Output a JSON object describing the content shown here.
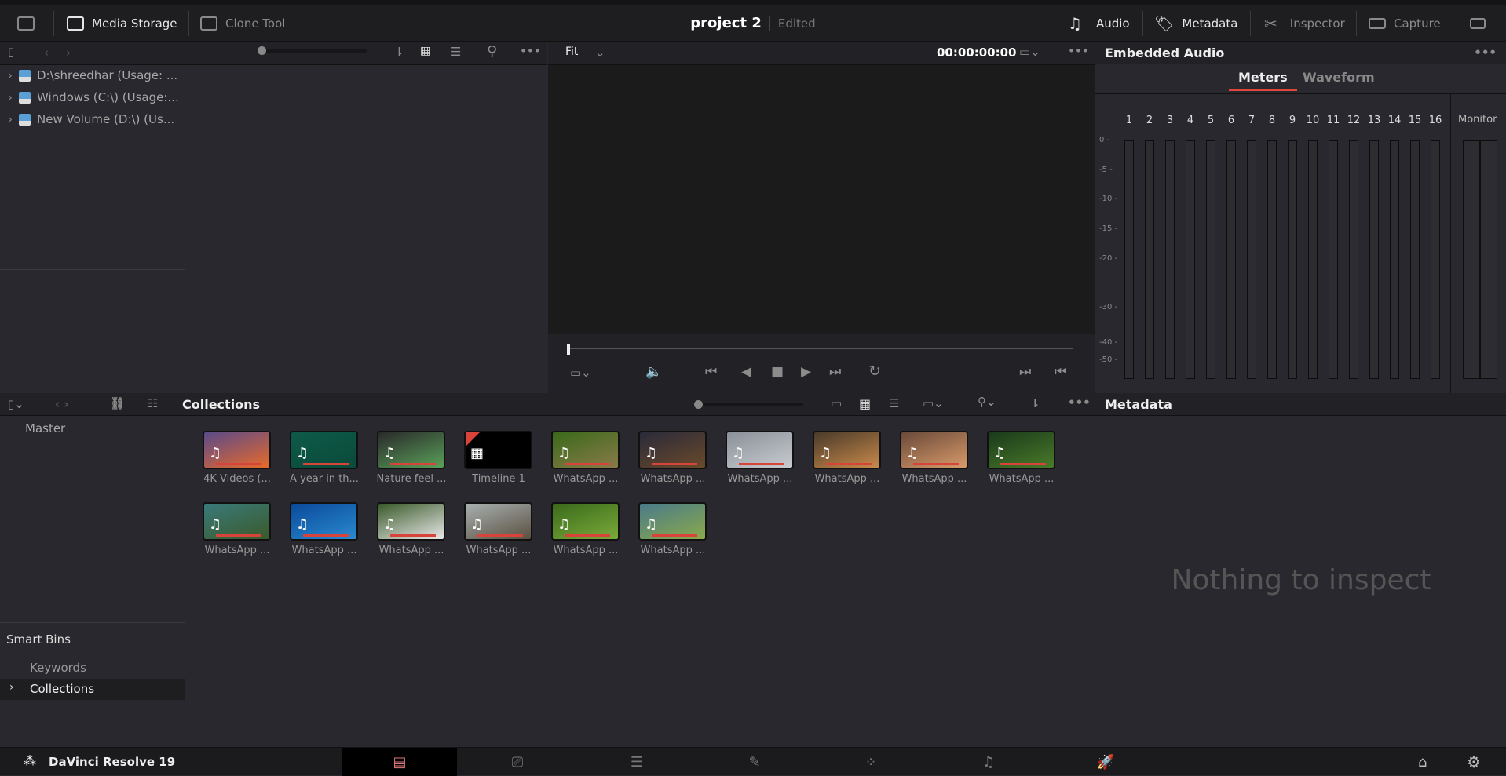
{
  "topbar": {
    "media_storage": "Media Storage",
    "clone_tool": "Clone Tool",
    "project_name": "project 2",
    "project_status": "Edited",
    "audio": "Audio",
    "metadata": "Metadata",
    "inspector": "Inspector",
    "capture": "Capture"
  },
  "viewer": {
    "zoom": "Fit",
    "timecode": "00:00:00:00"
  },
  "storage": {
    "drives": [
      "D:\\shreedhar (Usage: ...",
      "Windows (C:\\) (Usage:...",
      "New Volume (D:\\) (Us..."
    ]
  },
  "audio_panel": {
    "title": "Embedded Audio",
    "tabs": [
      "Meters",
      "Waveform"
    ],
    "active_tab": "Meters",
    "channels": [
      "1",
      "2",
      "3",
      "4",
      "5",
      "6",
      "7",
      "8",
      "9",
      "10",
      "11",
      "12",
      "13",
      "14",
      "15",
      "16"
    ],
    "monitor": "Monitor",
    "db_scale": [
      "0 -",
      "-5 -",
      "-10 -",
      "-15 -",
      "-20 -",
      "-30 -",
      "-40 -",
      "-50 -"
    ],
    "accent": "#e0463c"
  },
  "media_pool": {
    "title": "Collections",
    "bins": {
      "master": "Master",
      "smart_bins": "Smart Bins",
      "items": [
        "Keywords",
        "Collections"
      ]
    },
    "clips": [
      {
        "label": "4K Videos (...",
        "type": "audio",
        "colors": [
          "#5a4a8a",
          "#e86a2a"
        ]
      },
      {
        "label": "A year in th...",
        "type": "audio",
        "colors": [
          "#0e5a48",
          "#0a4a3a"
        ]
      },
      {
        "label": "Nature feel ...",
        "type": "waveform",
        "colors": [
          "#2a2a2a",
          "#5aa05a"
        ]
      },
      {
        "label": "Timeline 1",
        "type": "timeline",
        "colors": [
          "#000000",
          "#000000"
        ]
      },
      {
        "label": "WhatsApp ...",
        "type": "audio",
        "colors": [
          "#3a6a1a",
          "#8a7a4a"
        ]
      },
      {
        "label": "WhatsApp ...",
        "type": "audio",
        "colors": [
          "#2a2a3a",
          "#6a4a2a"
        ]
      },
      {
        "label": "WhatsApp ...",
        "type": "audio",
        "colors": [
          "#8a9098",
          "#c8ccd0"
        ]
      },
      {
        "label": "WhatsApp ...",
        "type": "audio",
        "colors": [
          "#4a3a2a",
          "#c88a4a"
        ]
      },
      {
        "label": "WhatsApp ...",
        "type": "audio",
        "colors": [
          "#6a4a3a",
          "#d89a6a"
        ]
      },
      {
        "label": "WhatsApp ...",
        "type": "audio",
        "colors": [
          "#1a3a1a",
          "#4a7a2a"
        ]
      },
      {
        "label": "WhatsApp ...",
        "type": "audio",
        "colors": [
          "#3a7a7a",
          "#3a5a2a"
        ]
      },
      {
        "label": "WhatsApp ...",
        "type": "audio",
        "colors": [
          "#0a4a9a",
          "#2a8ad0"
        ]
      },
      {
        "label": "WhatsApp ...",
        "type": "audio",
        "colors": [
          "#3a5a2a",
          "#e8e8e8"
        ]
      },
      {
        "label": "WhatsApp ...",
        "type": "audio",
        "colors": [
          "#a8b0b0",
          "#5a5040"
        ]
      },
      {
        "label": "WhatsApp ...",
        "type": "audio",
        "colors": [
          "#3a6a1a",
          "#7aaa3a"
        ]
      },
      {
        "label": "WhatsApp ...",
        "type": "audio",
        "colors": [
          "#4a7a8a",
          "#8aaa4a"
        ]
      }
    ]
  },
  "metadata_panel": {
    "title": "Metadata",
    "empty": "Nothing to inspect"
  },
  "bottom": {
    "app_name": "DaVinci Resolve 19",
    "pages": [
      "media",
      "cut",
      "edit",
      "fusion",
      "color",
      "fairlight",
      "deliver"
    ],
    "active_page": "media"
  }
}
